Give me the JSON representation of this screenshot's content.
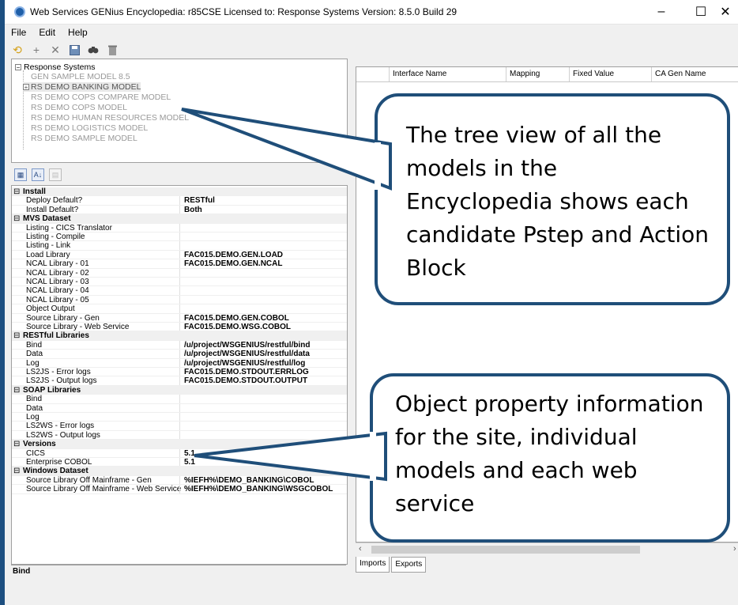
{
  "window": {
    "title": "Web Services GENius   Encyclopedia: r85CSE   Licensed to: Response Systems   Version: 8.5.0 Build 29",
    "minimize": "–",
    "maximize": "☐",
    "close": "✕"
  },
  "menu": [
    "File",
    "Edit",
    "Help"
  ],
  "toolbar_icons": [
    "refresh-icon",
    "add-icon",
    "delete-icon",
    "save-icon",
    "find-icon",
    "trash-icon"
  ],
  "tree": {
    "root": "Response Systems",
    "nodes": [
      "GEN SAMPLE MODEL 8.5",
      "RS DEMO BANKING MODEL",
      "RS DEMO COPS COMPARE MODEL",
      "RS DEMO COPS MODEL",
      "RS DEMO HUMAN RESOURCES MODEL",
      "RS DEMO LOGISTICS MODEL",
      "RS DEMO SAMPLE MODEL"
    ]
  },
  "properties": [
    {
      "cat": "Install"
    },
    {
      "k": "Deploy Default?",
      "v": "RESTful"
    },
    {
      "k": "Install Default?",
      "v": "Both"
    },
    {
      "cat": "MVS Dataset"
    },
    {
      "k": "Listing - CICS Translator",
      "v": ""
    },
    {
      "k": "Listing - Compile",
      "v": ""
    },
    {
      "k": "Listing - Link",
      "v": ""
    },
    {
      "k": "Load Library",
      "v": "FAC015.DEMO.GEN.LOAD"
    },
    {
      "k": "NCAL Library - 01",
      "v": "FAC015.DEMO.GEN.NCAL"
    },
    {
      "k": "NCAL Library - 02",
      "v": ""
    },
    {
      "k": "NCAL Library - 03",
      "v": ""
    },
    {
      "k": "NCAL Library - 04",
      "v": ""
    },
    {
      "k": "NCAL Library - 05",
      "v": ""
    },
    {
      "k": "Object Output",
      "v": ""
    },
    {
      "k": "Source Library - Gen",
      "v": "FAC015.DEMO.GEN.COBOL"
    },
    {
      "k": "Source Library - Web Service",
      "v": "FAC015.DEMO.WSG.COBOL"
    },
    {
      "cat": "RESTful Libraries"
    },
    {
      "k": "Bind",
      "v": "/u/project/WSGENIUS/restful/bind"
    },
    {
      "k": "Data",
      "v": "/u/project/WSGENIUS/restful/data"
    },
    {
      "k": "Log",
      "v": "/u/project/WSGENIUS/restful/log"
    },
    {
      "k": "LS2JS - Error logs",
      "v": "FAC015.DEMO.STDOUT.ERRLOG"
    },
    {
      "k": "LS2JS - Output logs",
      "v": "FAC015.DEMO.STDOUT.OUTPUT"
    },
    {
      "cat": "SOAP Libraries"
    },
    {
      "k": "Bind",
      "v": ""
    },
    {
      "k": "Data",
      "v": ""
    },
    {
      "k": "Log",
      "v": ""
    },
    {
      "k": "LS2WS - Error logs",
      "v": ""
    },
    {
      "k": "LS2WS - Output logs",
      "v": ""
    },
    {
      "cat": "Versions"
    },
    {
      "k": "CICS",
      "v": "5.1"
    },
    {
      "k": "Enterprise COBOL",
      "v": "5.1"
    },
    {
      "cat": "Windows Dataset"
    },
    {
      "k": "Source Library Off Mainframe - Gen",
      "v": "%IEFH%\\DEMO_BANKING\\COBOL"
    },
    {
      "k": "Source Library Off Mainframe - Web Service",
      "v": "%IEFH%\\DEMO_BANKING\\WSGCOBOL"
    }
  ],
  "description": {
    "label": "Bind"
  },
  "grid": {
    "columns": [
      "Interface Name",
      "Mapping",
      "Fixed Value",
      "CA Gen Name"
    ]
  },
  "tabs": [
    "Imports",
    "Exports"
  ],
  "callouts": {
    "tree": "The tree view of all the models in the Encyclopedia shows each candidate Pstep and Action Block",
    "props": "Object property information for the site, individual models and each web service"
  }
}
